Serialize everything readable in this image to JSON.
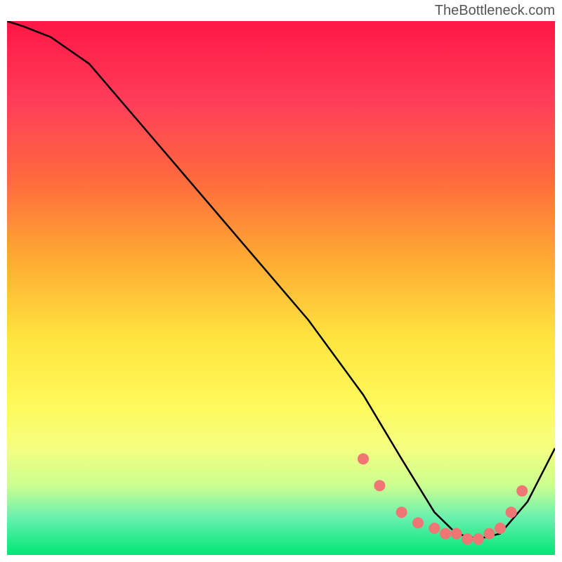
{
  "watermark": "TheBottleneck.com",
  "chart_data": {
    "type": "line",
    "title": "",
    "xlabel": "",
    "ylabel": "",
    "xlim": [
      0,
      100
    ],
    "ylim": [
      0,
      100
    ],
    "series": [
      {
        "name": "curve",
        "x": [
          0,
          3,
          8,
          15,
          25,
          35,
          45,
          55,
          65,
          72,
          78,
          82,
          86,
          90,
          95,
          100
        ],
        "y": [
          100,
          99,
          97,
          92,
          80,
          68,
          56,
          44,
          30,
          18,
          8,
          4,
          3,
          4,
          10,
          20
        ]
      }
    ],
    "markers": {
      "x": [
        65,
        68,
        72,
        75,
        78,
        80,
        82,
        84,
        86,
        88,
        90,
        92,
        94
      ],
      "y": [
        18,
        13,
        8,
        6,
        5,
        4,
        4,
        3,
        3,
        4,
        5,
        8,
        12
      ]
    },
    "gradient_stops": [
      {
        "offset": 0,
        "color": "#ff1744"
      },
      {
        "offset": 15,
        "color": "#ff3d5a"
      },
      {
        "offset": 30,
        "color": "#ff6b3d"
      },
      {
        "offset": 45,
        "color": "#ffac33"
      },
      {
        "offset": 60,
        "color": "#ffe640"
      },
      {
        "offset": 72,
        "color": "#fff95c"
      },
      {
        "offset": 80,
        "color": "#f4ff81"
      },
      {
        "offset": 87,
        "color": "#ccff90"
      },
      {
        "offset": 93,
        "color": "#69f0ae"
      },
      {
        "offset": 100,
        "color": "#00e676"
      }
    ]
  }
}
